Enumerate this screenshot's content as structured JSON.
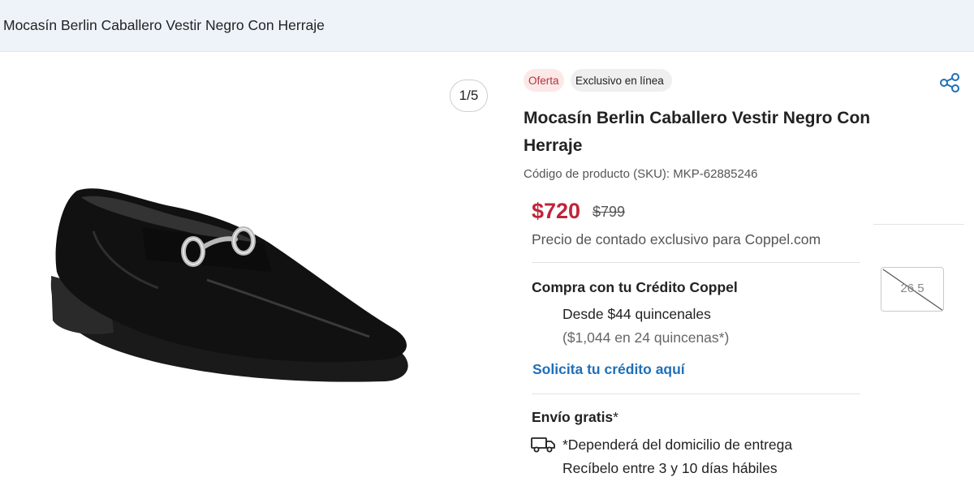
{
  "header": {
    "title": "Mocasín Berlin Caballero Vestir Negro Con Herraje"
  },
  "gallery": {
    "counter": "1/5",
    "image_icon": "loafer-shoe-image"
  },
  "badges": {
    "offer": "Oferta",
    "online": "Exclusivo en línea"
  },
  "product": {
    "title": "Mocasín Berlin Caballero Vestir Negro Con Herraje",
    "sku": "Código de producto (SKU): MKP-62885246"
  },
  "pricing": {
    "price": "$720",
    "old_price": "$799",
    "note": "Precio de contado exclusivo para Coppel.com"
  },
  "credit": {
    "title": "Compra con tu Crédito Coppel",
    "from": "Desde $44 quincenales",
    "total": "($1,044 en 24 quincenas*)",
    "link": "Solicita tu crédito aquí"
  },
  "shipping": {
    "title": "Envío gratis",
    "asterisk": "*",
    "note": "*Dependerá del domicilio de entrega",
    "time": "Recíbelo entre 3 y 10 días hábiles"
  },
  "sizes": {
    "selected": "26.5"
  },
  "colors": {
    "accent_price": "#c0243a",
    "link": "#1f6fb8",
    "offer_bg": "#fde8e8"
  },
  "icons": {
    "share": "share-icon",
    "shipping": "truck-icon"
  }
}
